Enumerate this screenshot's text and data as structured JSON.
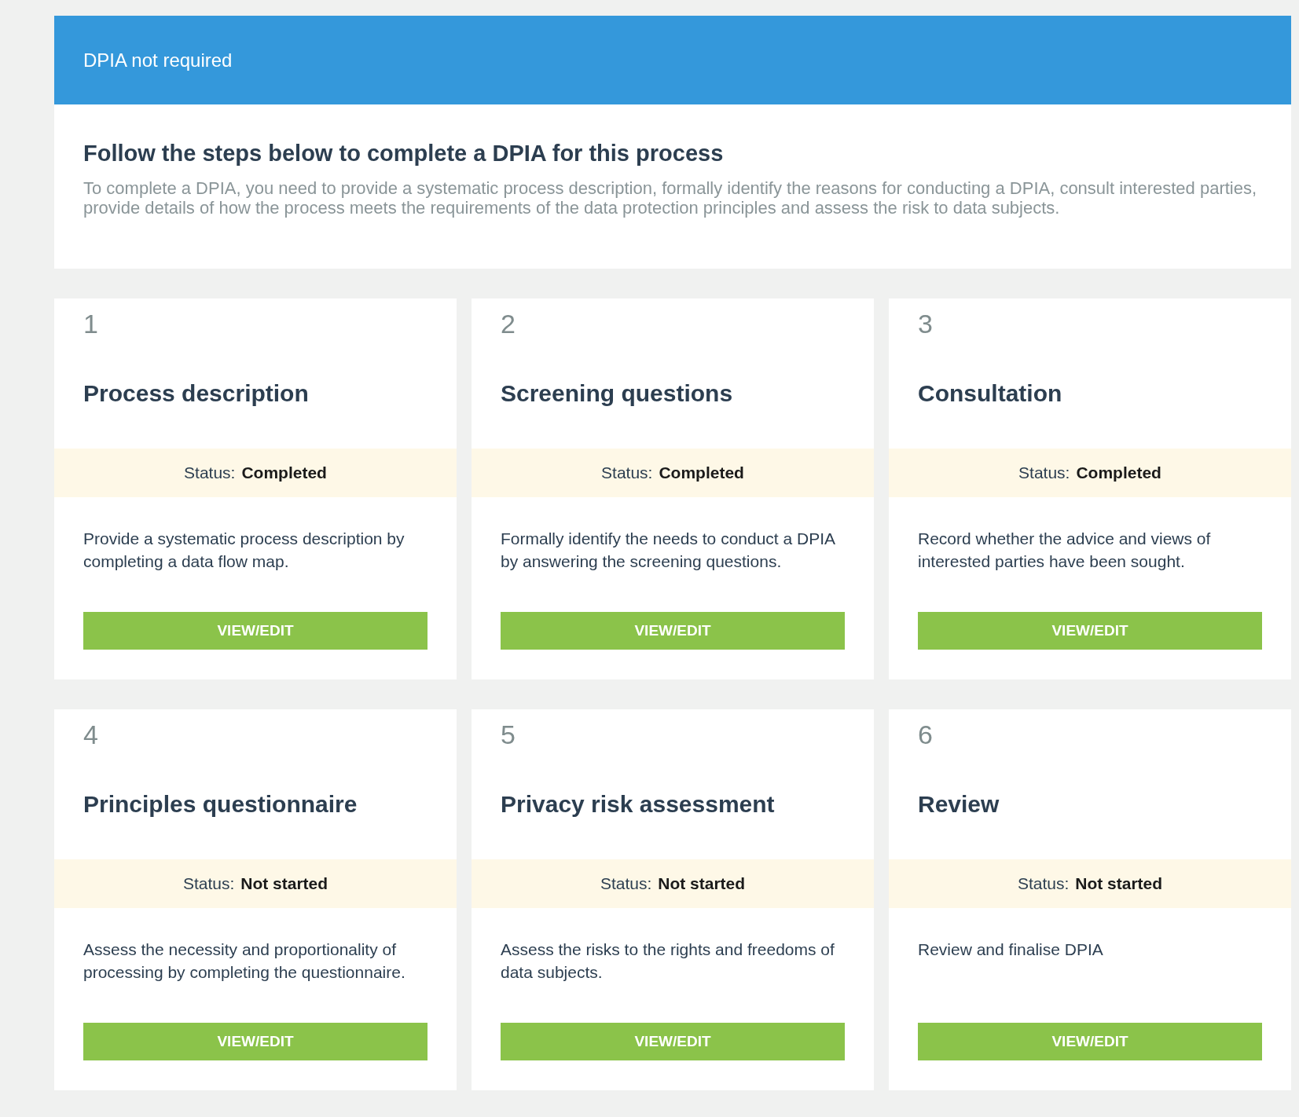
{
  "banner": {
    "title": "DPIA not required"
  },
  "intro": {
    "heading": "Follow the steps below to complete a DPIA for this process",
    "text": "To complete a DPIA, you need to provide a systematic process description, formally identify the reasons for conducting a DPIA, consult interested parties, provide details of how the process meets the requirements of the data protection principles and assess the risk to data subjects."
  },
  "steps": [
    {
      "number": "1",
      "title": "Process description",
      "status_label": "Status:",
      "status": "Completed",
      "description": "Provide a systematic process description by completing a data flow map.",
      "button": "VIEW/EDIT"
    },
    {
      "number": "2",
      "title": "Screening questions",
      "status_label": "Status:",
      "status": "Completed",
      "description": "Formally identify the needs to conduct a DPIA by answering the screening questions.",
      "button": "VIEW/EDIT"
    },
    {
      "number": "3",
      "title": "Consultation",
      "status_label": "Status:",
      "status": "Completed",
      "description": "Record whether the advice and views of interested parties have been sought.",
      "button": "VIEW/EDIT"
    },
    {
      "number": "4",
      "title": "Principles questionnaire",
      "status_label": "Status:",
      "status": "Not started",
      "description": "Assess the necessity and proportionality of processing by completing the questionnaire.",
      "button": "VIEW/EDIT"
    },
    {
      "number": "5",
      "title": "Privacy risk assessment",
      "status_label": "Status:",
      "status": "Not started",
      "description": "Assess the risks to the rights and freedoms of data subjects.",
      "button": "VIEW/EDIT"
    },
    {
      "number": "6",
      "title": "Review",
      "status_label": "Status:",
      "status": "Not started",
      "description": "Review and finalise DPIA",
      "button": "VIEW/EDIT"
    }
  ]
}
